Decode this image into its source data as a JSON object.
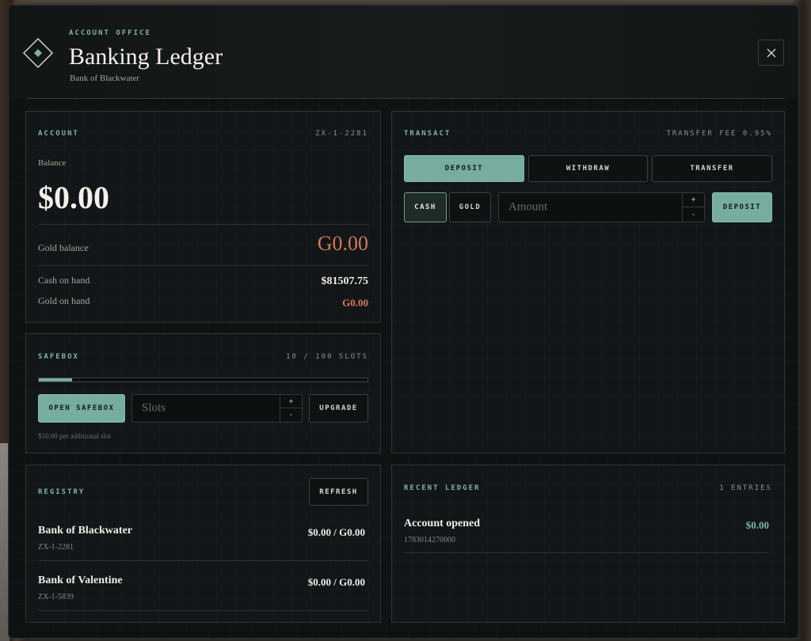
{
  "header": {
    "eyebrow": "ACCOUNT OFFICE",
    "title": "Banking Ledger",
    "subtitle": "Bank of Blackwater"
  },
  "account": {
    "label": "ACCOUNT",
    "account_id": "ZX-1-2281",
    "balance_label": "Balance",
    "balance_value": "$0.00",
    "gold_balance_label": "Gold balance",
    "gold_balance_value": "G0.00",
    "cash_on_hand_label": "Cash on hand",
    "cash_on_hand_value": "$81507.75",
    "gold_on_hand_label": "Gold on hand",
    "gold_on_hand_value": "G0.00"
  },
  "safebox": {
    "label": "SAFEBOX",
    "slots_text": "10 / 100 SLOTS",
    "fill_fraction": 0.1,
    "open_label": "OPEN SAFEBOX",
    "slots_placeholder": "Slots",
    "upgrade_label": "UPGRADE",
    "note": "$10.00 per additional slot"
  },
  "transact": {
    "label": "TRANSACT",
    "fee_text": "TRANSFER FEE 0.95%",
    "tabs": [
      "DEPOSIT",
      "WITHDRAW",
      "TRANSFER"
    ],
    "active_tab": "DEPOSIT",
    "currency_options": [
      "CASH",
      "GOLD"
    ],
    "active_currency": "CASH",
    "amount_placeholder": "Amount",
    "submit_label": "DEPOSIT"
  },
  "stepper": {
    "plus": "+",
    "minus": "-"
  },
  "registry": {
    "label": "REGISTRY",
    "refresh_label": "REFRESH",
    "banks": [
      {
        "name": "Bank of Blackwater",
        "id": "ZX-1-2281",
        "balances": "$0.00 / G0.00"
      },
      {
        "name": "Bank of Valentine",
        "id": "ZX-1-5839",
        "balances": "$0.00 / G0.00"
      }
    ]
  },
  "ledger": {
    "label": "RECENT LEDGER",
    "entries_text": "1 ENTRIES",
    "entries": [
      {
        "title": "Account opened",
        "timestamp": "1783014270000",
        "amount": "$0.00"
      }
    ]
  },
  "colors": {
    "accent": "#77ad9e",
    "gold": "#d07a54",
    "background": "#0f1213"
  }
}
